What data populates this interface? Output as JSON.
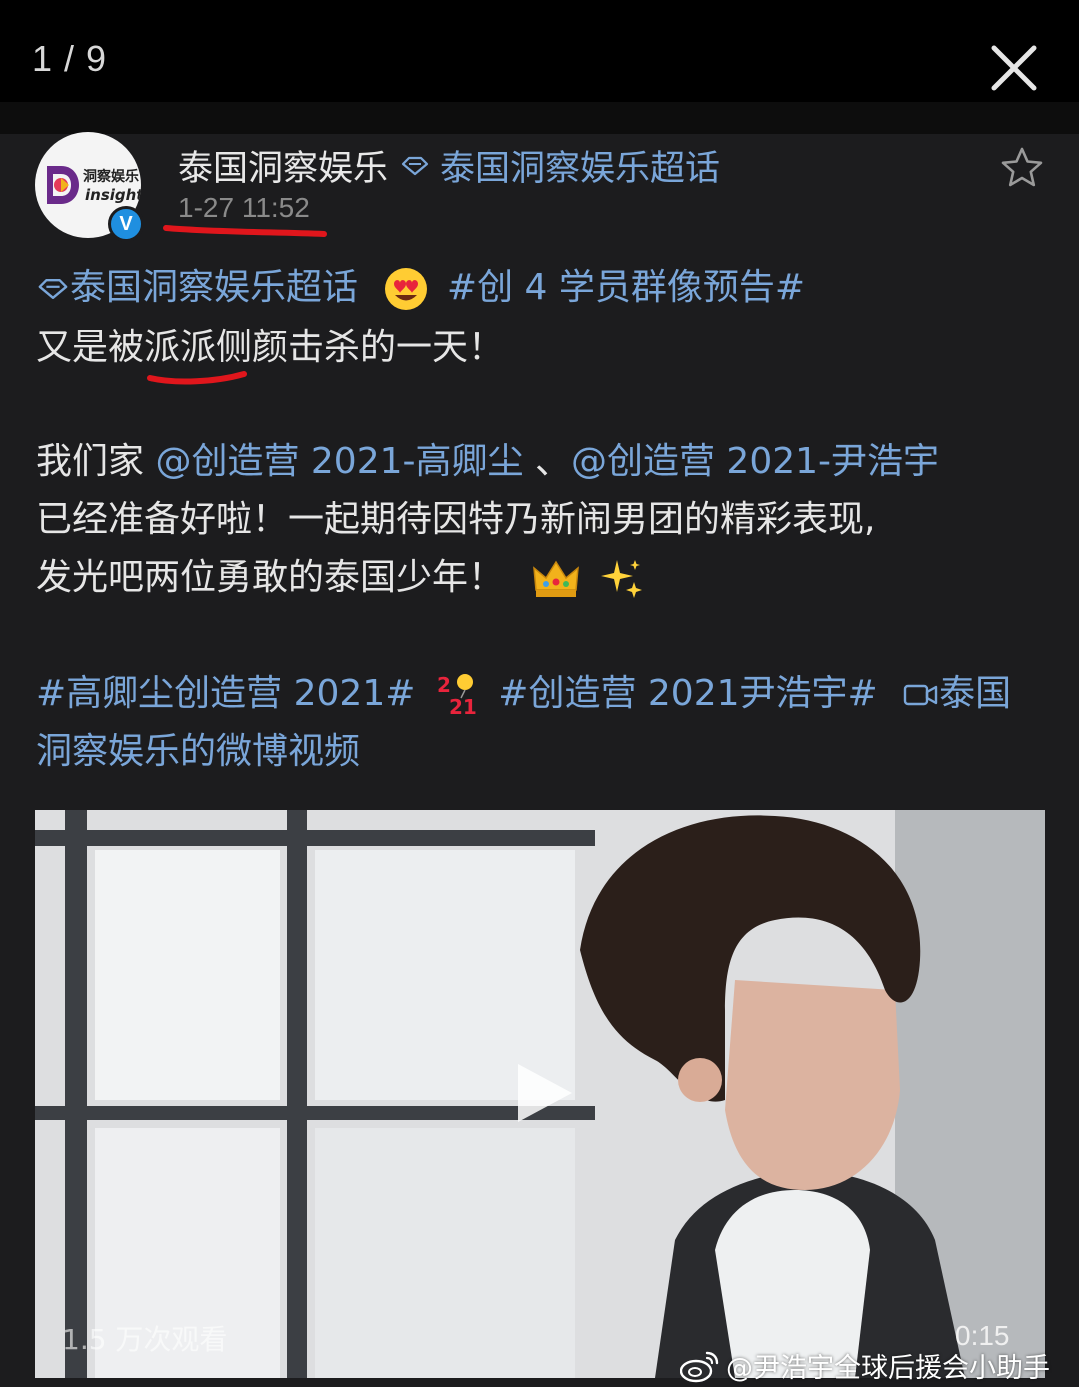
{
  "viewer": {
    "counter": "1 / 9",
    "close_icon": "close-icon"
  },
  "post": {
    "author": "泰国洞察娱乐",
    "topic": "泰国洞察娱乐超话",
    "timestamp": "1-27 11:52",
    "avatar": {
      "text_cn": "洞察娱乐",
      "text_en": "insight",
      "verified_mark": "V"
    },
    "lines": {
      "l1_topic": "泰国洞察娱乐超话",
      "l1_tag": "#创 4 学员群像预告#",
      "l2": "又是被派派侧颜击杀的一天！",
      "l3_prefix": "我们家 ",
      "l3_mention1": "@创造营 2021-高卿尘",
      "l3_sep": " 、",
      "l3_mention2": "@创造营 2021-尹浩宇",
      "l4": "已经准备好啦！一起期待因特乃新闹男团的精彩表现,",
      "l5": "发光吧两位勇敢的泰国少年！",
      "l6_tag1": "#高卿尘创造营 2021#",
      "l6_tag2": "#创造营 2021尹浩宇#",
      "l6_video_link": "泰国",
      "l7": "洞察娱乐的微博视频"
    },
    "emojis": [
      "heart-eyes-emoji",
      "crown-emoji",
      "sparkles-emoji",
      "balloon-2021-emoji"
    ]
  },
  "video": {
    "views": "1.5 万次观看",
    "duration": "0:15"
  },
  "watermark": "@尹浩宇全球后援会小助手",
  "colors": {
    "link": "#7aa6d9",
    "card": "#1c1c1e",
    "annotation": "#e0161c"
  }
}
